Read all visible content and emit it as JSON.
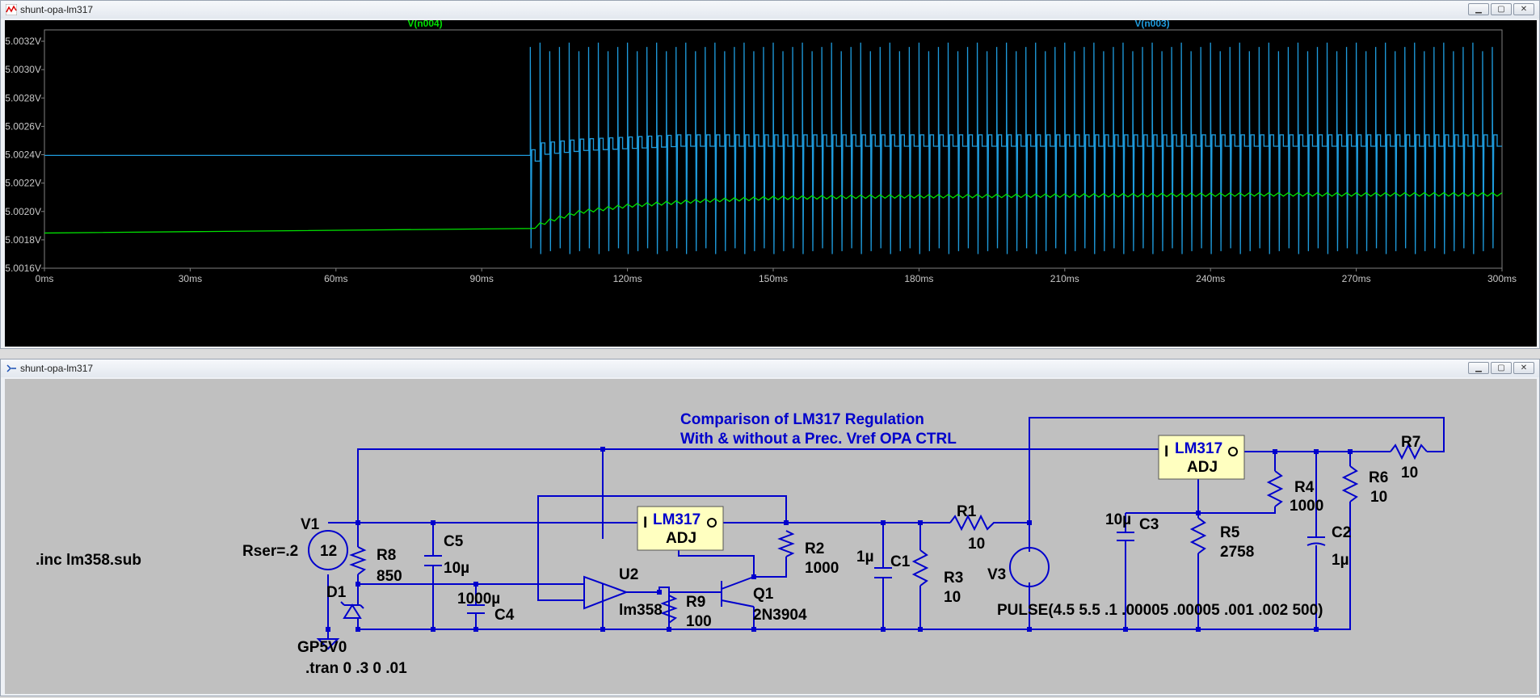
{
  "plot_window": {
    "title": "shunt-opa-lm317",
    "buttons": {
      "minimize": "▁",
      "maximize": "▢",
      "close": "✕"
    },
    "colors": {
      "background": "#000000",
      "grid": "#808080",
      "axis_text": "#c8c8c8",
      "trace_n004": "#00e000",
      "trace_n003": "#1e9bdc"
    }
  },
  "chart_data": {
    "type": "line",
    "xlabel": "",
    "ylabel": "",
    "x_ticks": [
      "0ms",
      "30ms",
      "60ms",
      "90ms",
      "120ms",
      "150ms",
      "180ms",
      "210ms",
      "240ms",
      "270ms",
      "300ms"
    ],
    "y_ticks": [
      "5.0016V",
      "5.0018V",
      "5.0020V",
      "5.0022V",
      "5.0024V",
      "5.0026V",
      "5.0028V",
      "5.0030V",
      "5.0032V"
    ],
    "xlim": [
      0,
      300
    ],
    "ylim": [
      5.0016,
      5.00328
    ],
    "series": [
      {
        "name": "V(n004)",
        "color": "#00e000",
        "description_values": {
          "x": [
            0,
            99,
            100,
            104,
            110,
            120,
            135,
            150,
            170,
            200,
            250,
            300
          ],
          "y": [
            5.001848,
            5.001848,
            5.00188,
            5.001935,
            5.001995,
            5.00204,
            5.002075,
            5.002095,
            5.002105,
            5.00211,
            5.00212,
            5.00212
          ]
        }
      },
      {
        "name": "V(n003)",
        "color": "#1e9bdc",
        "baseline": {
          "x": [
            0,
            100,
            101,
            110,
            130,
            300
          ],
          "y": [
            5.002395,
            5.002395,
            5.00244,
            5.00247,
            5.0025,
            5.0025
          ]
        },
        "spikes": {
          "start": 100,
          "end": 300,
          "period": 2,
          "high": 5.00319,
          "low": 5.0017
        }
      }
    ]
  },
  "schematic_window": {
    "title": "shunt-opa-lm317",
    "buttons": {
      "minimize": "▁",
      "maximize": "▢",
      "close": "✕"
    }
  },
  "schematic": {
    "comment_line1": "Comparison of LM317 Regulation",
    "comment_line2": "With & without a Prec. Vref OPA CTRL",
    "directive_inc": ".inc lm358.sub",
    "directive_tran": ".tran 0 .3 0 .01",
    "v1": {
      "name": "V1",
      "value": "12",
      "rser": "Rser=.2"
    },
    "v3": {
      "name": "V3",
      "pulse": "PULSE(4.5 5.5 .1 .00005 .00005 .001 .002 500)"
    },
    "reg1": {
      "part": "LM317",
      "in": "I",
      "out": "O",
      "adj": "ADJ"
    },
    "reg2": {
      "part": "LM317",
      "in": "I",
      "out": "O",
      "adj": "ADJ"
    },
    "r1": {
      "name": "R1",
      "value": "10"
    },
    "r2": {
      "name": "R2",
      "value": "1000"
    },
    "r3": {
      "name": "R3",
      "value": "10"
    },
    "r4": {
      "name": "R4",
      "value": "1000"
    },
    "r5": {
      "name": "R5",
      "value": "2758"
    },
    "r6": {
      "name": "R6",
      "value": "10"
    },
    "r7": {
      "name": "R7",
      "value": "10"
    },
    "r8": {
      "name": "R8",
      "value": "850"
    },
    "r9": {
      "name": "R9",
      "value": "100"
    },
    "c1": {
      "name": "C1",
      "value": "1µ"
    },
    "c2": {
      "name": "C2",
      "value": "1µ"
    },
    "c3": {
      "name": "C3",
      "value": "10µ"
    },
    "c4": {
      "name": "C4",
      "value": "1000µ"
    },
    "c5": {
      "name": "C5",
      "value": "10µ"
    },
    "d1": {
      "name": "D1",
      "value": "GP5V0"
    },
    "q1": {
      "name": "Q1",
      "value": "2N3904"
    },
    "u2": {
      "name": "U2",
      "value": "lm358"
    }
  }
}
